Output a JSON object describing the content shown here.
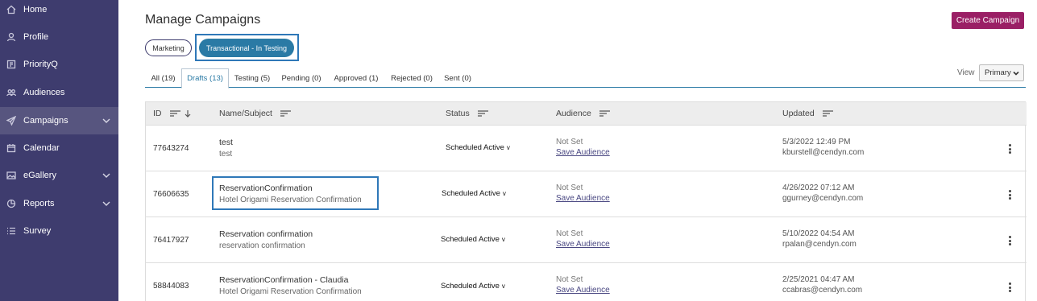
{
  "sidebar": {
    "items": [
      {
        "label": "Home",
        "icon": "home-icon",
        "chevron": false,
        "active": false
      },
      {
        "label": "Profile",
        "icon": "user-icon",
        "chevron": false,
        "active": false
      },
      {
        "label": "PriorityQ",
        "icon": "priority-icon",
        "chevron": false,
        "active": false
      },
      {
        "label": "Audiences",
        "icon": "audiences-icon",
        "chevron": false,
        "active": false
      },
      {
        "label": "Campaigns",
        "icon": "send-icon",
        "chevron": true,
        "active": true
      },
      {
        "label": "Calendar",
        "icon": "calendar-icon",
        "chevron": false,
        "active": false
      },
      {
        "label": "eGallery",
        "icon": "image-icon",
        "chevron": true,
        "active": false
      },
      {
        "label": "Reports",
        "icon": "pie-chart-icon",
        "chevron": true,
        "active": false
      },
      {
        "label": "Survey",
        "icon": "list-icon",
        "chevron": false,
        "active": false
      }
    ]
  },
  "page": {
    "title": "Manage Campaigns",
    "create_label": "Create Campaign"
  },
  "type_pills": {
    "marketing": "Marketing",
    "transactional": "Transactional - In Testing"
  },
  "tabs": [
    {
      "label": "All (19)"
    },
    {
      "label": "Drafts (13)"
    },
    {
      "label": "Testing (5)"
    },
    {
      "label": "Pending (0)"
    },
    {
      "label": "Approved (1)"
    },
    {
      "label": "Rejected (0)"
    },
    {
      "label": "Sent (0)"
    }
  ],
  "active_tab": "Drafts (13)",
  "view": {
    "label": "View",
    "selected": "Primary"
  },
  "table": {
    "columns": {
      "id": "ID",
      "name": "Name/Subject",
      "status": "Status",
      "audience": "Audience",
      "updated": "Updated"
    },
    "rows": [
      {
        "id": "77643274",
        "name": "test",
        "subject": "test",
        "status": "Scheduled Active",
        "audience": "Not Set",
        "audience_action": "Save Audience",
        "updated": "5/3/2022 12:49 PM",
        "user": "kburstell@cendyn.com"
      },
      {
        "id": "76606635",
        "name": "ReservationConfirmation",
        "subject": "Hotel Origami Reservation Confirmation",
        "status": "Scheduled Active",
        "audience": "Not Set",
        "audience_action": "Save Audience",
        "updated": "4/26/2022 07:12 AM",
        "user": "ggurney@cendyn.com"
      },
      {
        "id": "76417927",
        "name": "Reservation confirmation",
        "subject": "reservation confirmation",
        "status": "Scheduled Active",
        "audience": "Not Set",
        "audience_action": "Save Audience",
        "updated": "5/10/2022 04:54 AM",
        "user": "rpalan@cendyn.com"
      },
      {
        "id": "58844083",
        "name": "ReservationConfirmation - Claudia",
        "subject": "Hotel Origami Reservation Confirmation",
        "status": "Scheduled Active",
        "audience": "Not Set",
        "audience_action": "Save Audience",
        "updated": "2/25/2021 04:47 AM",
        "user": "ccabras@cendyn.com"
      }
    ]
  },
  "colors": {
    "sidebar_bg": "#3e3c6e",
    "accent": "#2a7aa5",
    "create_button": "#9a1f65",
    "highlight_box": "#2f78b8"
  }
}
